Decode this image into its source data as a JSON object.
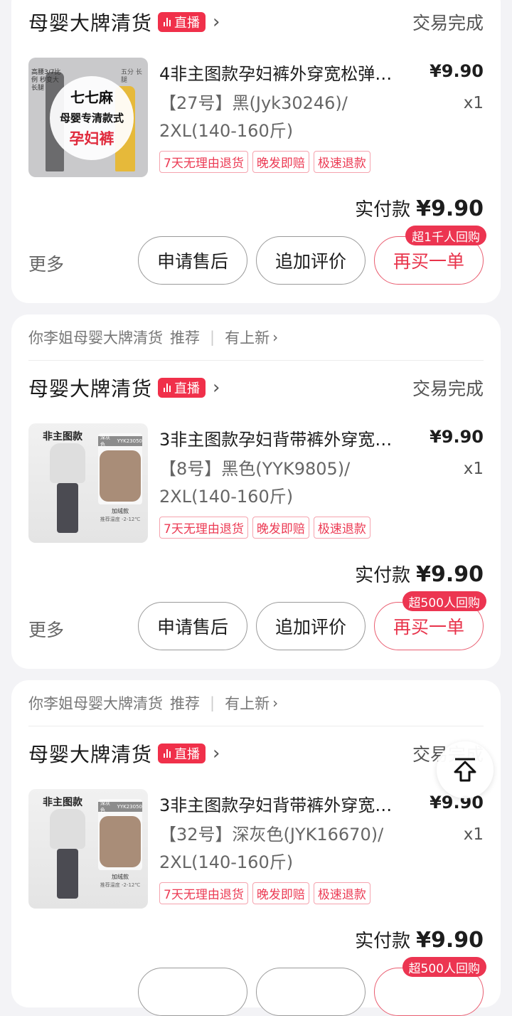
{
  "orders": [
    {
      "shop": "母婴大牌清货",
      "live_label": "直播",
      "status": "交易完成",
      "title": "4非主图款孕妇裤外穿宽松弹…",
      "price": "¥9.90",
      "spec_line1": "【27号】黑(Jyk30246)/",
      "spec_line2": "2XL(140-160斤)",
      "qty": "x1",
      "tags": [
        "7天无理由退货",
        "晚发即赔",
        "极速退款"
      ],
      "paid_label": "实付款",
      "paid_amount": "¥9.90",
      "more": "更多",
      "btn_after_sale": "申请售后",
      "btn_review": "追加评价",
      "btn_rebuy": "再买一单",
      "rebuy_hint": "超1千人回购",
      "thumb": {
        "text1": "七七麻",
        "text2": "母婴专清款式",
        "text3": "孕妇裤",
        "side_left": "高腰3/7比例 秒变大长腿",
        "side_right": "五分 长腿"
      }
    },
    {
      "recommend": {
        "shop": "你李姐母婴大牌清货",
        "label": "推荐",
        "new": "有上新"
      },
      "shop": "母婴大牌清货",
      "live_label": "直播",
      "status": "交易完成",
      "title": "3非主图款孕妇背带裤外穿宽…",
      "price": "¥9.90",
      "spec_line1": "【8号】黑色(YYK9805)/",
      "spec_line2": "2XL(140-160斤)",
      "qty": "x1",
      "tags": [
        "7天无理由退货",
        "晚发即赔",
        "极速退款"
      ],
      "paid_label": "实付款",
      "paid_amount": "¥9.90",
      "more": "更多",
      "btn_after_sale": "申请售后",
      "btn_review": "追加评价",
      "btn_rebuy": "再买一单",
      "rebuy_hint": "超500人回购",
      "thumb": {
        "label": "非主图款",
        "swatch_label": "深灰色",
        "swatch_code": "YYK23050",
        "caption": "加绒款",
        "caption2": "推荐温度 -2-12℃"
      }
    },
    {
      "recommend": {
        "shop": "你李姐母婴大牌清货",
        "label": "推荐",
        "new": "有上新"
      },
      "shop": "母婴大牌清货",
      "live_label": "直播",
      "status": "交易完成",
      "title": "3非主图款孕妇背带裤外穿宽…",
      "price": "¥9.90",
      "spec_line1": "【32号】深灰色(JYK16670)/",
      "spec_line2": "2XL(140-160斤)",
      "qty": "x1",
      "tags": [
        "7天无理由退货",
        "晚发即赔",
        "极速退款"
      ],
      "paid_label": "实付款",
      "paid_amount": "¥9.90",
      "rebuy_hint": "超500人回购",
      "thumb": {
        "label": "非主图款",
        "swatch_label": "深灰色",
        "swatch_code": "YYK23050",
        "caption": "加绒款",
        "caption2": "推荐温度 -2-12℃"
      }
    }
  ],
  "colors": {
    "accent": "#f0304a",
    "background": "#f3f3f6"
  },
  "icons": {
    "back_to_top": "arrow-up-icon",
    "chevron": "chevron-right-icon",
    "live": "live-bars-icon"
  }
}
